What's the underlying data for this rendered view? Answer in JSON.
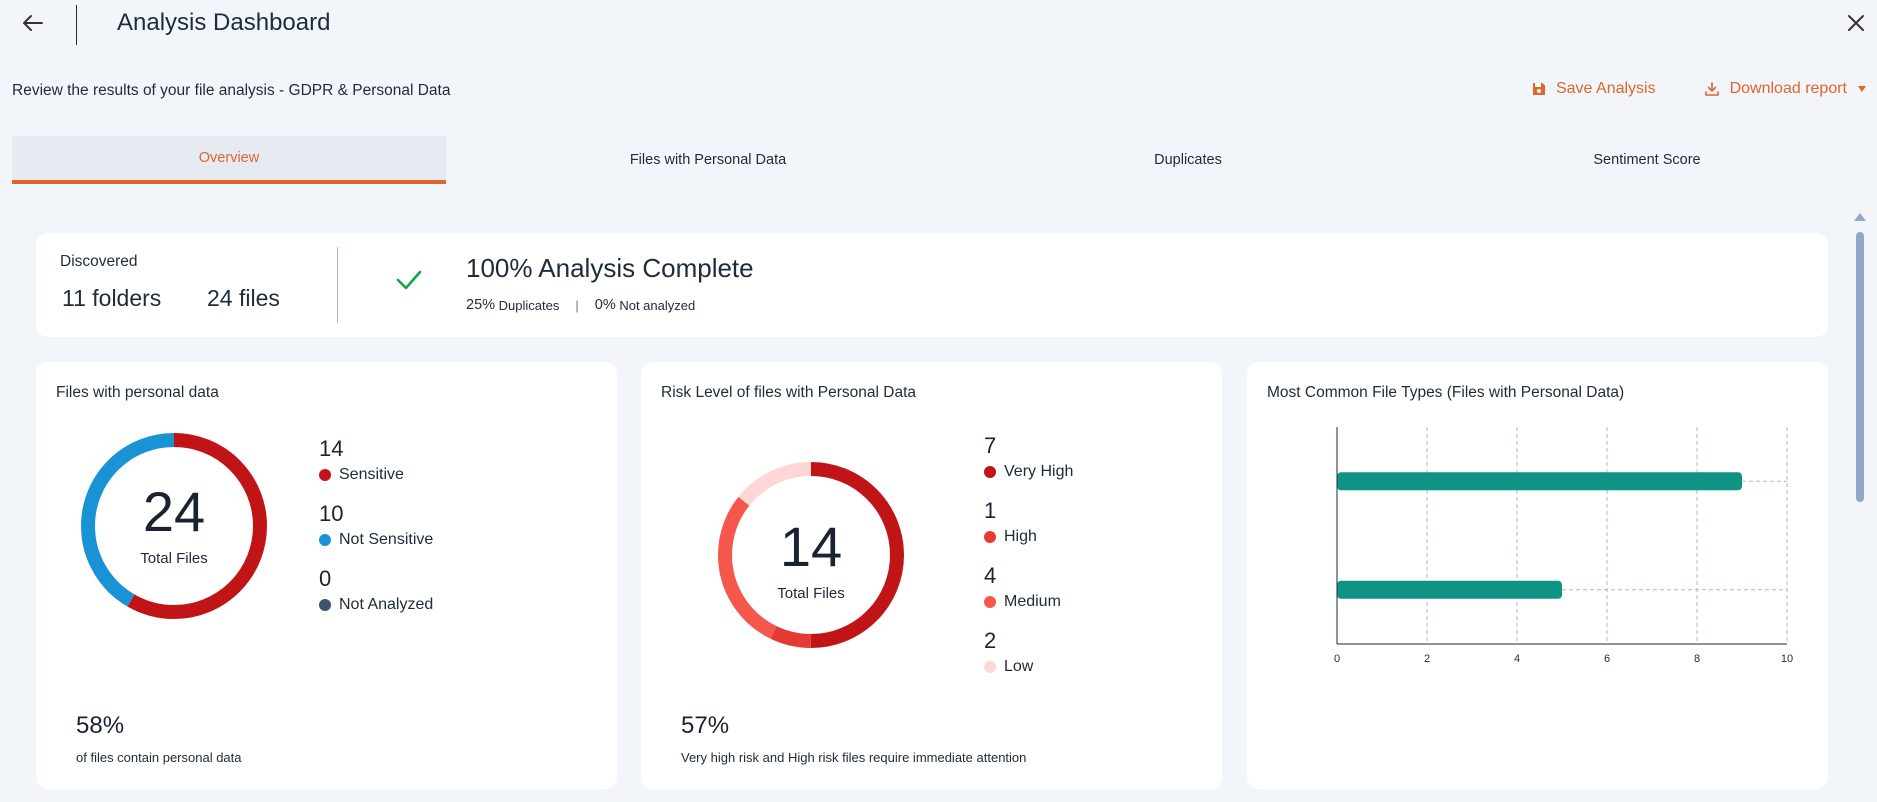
{
  "app": {
    "title": "Analysis Dashboard",
    "subtitle": "Review the results of your file analysis - GDPR & Personal Data"
  },
  "actions": {
    "save_label": "Save Analysis",
    "download_label": "Download report"
  },
  "tabs": [
    {
      "label": "Overview",
      "active": true
    },
    {
      "label": "Files with Personal Data",
      "active": false
    },
    {
      "label": "Duplicates",
      "active": false
    },
    {
      "label": "Sentiment Score",
      "active": false
    }
  ],
  "summary": {
    "discovered_label": "Discovered",
    "folders": "11 folders",
    "files": "24 files",
    "complete_pct": "100%",
    "complete_label": "Analysis Complete",
    "duplicates_pct": "25%",
    "duplicates_label": "Duplicates",
    "not_analyzed_pct": "0%",
    "not_analyzed_label": "Not analyzed"
  },
  "personal_data": {
    "title": "Files with personal data",
    "total": "24",
    "total_label": "Total Files",
    "legend": [
      {
        "count": "14",
        "label": "Sensitive",
        "color": "#c11417"
      },
      {
        "count": "10",
        "label": "Not Sensitive",
        "color": "#1a93d6"
      },
      {
        "count": "0",
        "label": "Not Analyzed",
        "color": "#3d5370"
      }
    ],
    "footer_pct": "58%",
    "footer_text": "of files contain personal data"
  },
  "risk": {
    "title": "Risk Level of files with Personal Data",
    "total": "14",
    "total_label": "Total Files",
    "legend": [
      {
        "count": "7",
        "label": "Very High",
        "color": "#c11417"
      },
      {
        "count": "1",
        "label": "High",
        "color": "#e53a31"
      },
      {
        "count": "4",
        "label": "Medium",
        "color": "#f5574d"
      },
      {
        "count": "2",
        "label": "Low",
        "color": "#fdd6d5"
      }
    ],
    "footer_pct": "57%",
    "footer_text": "Very high risk and High risk files require immediate attention"
  },
  "file_types": {
    "title": "Most Common File Types (Files with Personal Data)"
  },
  "chart_data": [
    {
      "type": "pie",
      "title": "Files with personal data",
      "categories": [
        "Sensitive",
        "Not Sensitive",
        "Not Analyzed"
      ],
      "values": [
        14,
        10,
        0
      ],
      "colors": [
        "#c11417",
        "#1a93d6",
        "#3d5370"
      ]
    },
    {
      "type": "pie",
      "title": "Risk Level of files with Personal Data",
      "categories": [
        "Very High",
        "High",
        "Medium",
        "Low"
      ],
      "values": [
        7,
        1,
        4,
        2
      ],
      "colors": [
        "#c11417",
        "#e53a31",
        "#f5574d",
        "#fdd6d5"
      ]
    },
    {
      "type": "bar",
      "orientation": "horizontal",
      "title": "Most Common File Types (Files with Personal Data)",
      "categories": [
        "",
        ""
      ],
      "values": [
        9,
        5
      ],
      "xlim": [
        0,
        10
      ],
      "xticks": [
        0,
        2,
        4,
        6,
        8,
        10
      ],
      "grid": true,
      "bar_color": "#0e9384"
    }
  ]
}
